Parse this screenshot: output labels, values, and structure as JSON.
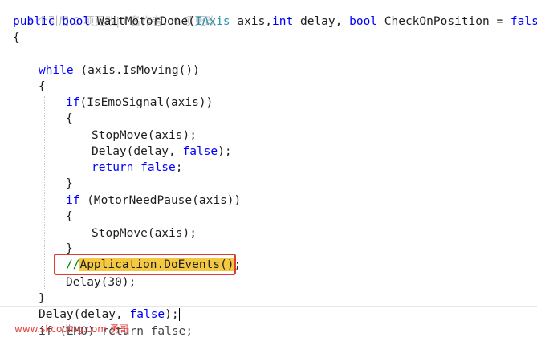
{
  "codelens": "3 个引用|0 项更改|0 名作者，0 项更改",
  "lines": {
    "sig_public": "public",
    "sig_bool": "bool",
    "sig_name": "WaitMotorDone(",
    "sig_iaxis": "IAxis",
    "sig_axis": "axis,",
    "sig_int": "int",
    "sig_delay": "delay,",
    "sig_bool2": "bool",
    "sig_check": "CheckOnPosition = ",
    "sig_false": "false",
    "sig_close": ")",
    "open_brace": "{",
    "while_kw": "while",
    "while_cond": " (axis.IsMoving())",
    "while_open": "{",
    "if1_kw": "if",
    "if1_cond": "(IsEmoSignal(axis))",
    "if1_open": "{",
    "stopmove1": "StopMove(axis);",
    "delay_pre": "Delay(delay, ",
    "delay_false": "false",
    "delay_post": ");",
    "return_kw": "return",
    "return_false": " false",
    "return_semi": ";",
    "if1_close": "}",
    "if2_kw": "if",
    "if2_cond": " (MotorNeedPause(axis))",
    "if2_open": "{",
    "stopmove2": "StopMove(axis);",
    "if2_close": "}",
    "comment_slashes": "//",
    "comment_code": "Application.DoEvents()",
    "comment_semi": ";",
    "delay30": "Delay(30);",
    "while_close": "}",
    "final_delay_pre": "Delay(delay, ",
    "final_delay_false": "false",
    "final_delay_post": ");",
    "last_if": "if (EMO) return false;"
  },
  "watermark": "www.skcoding.com 勇哥",
  "colors": {
    "keyword": "#0000ff",
    "type": "#2b91af",
    "comment": "#008000",
    "highlight": "#f5c842",
    "annotation_box": "#e23b2e"
  }
}
